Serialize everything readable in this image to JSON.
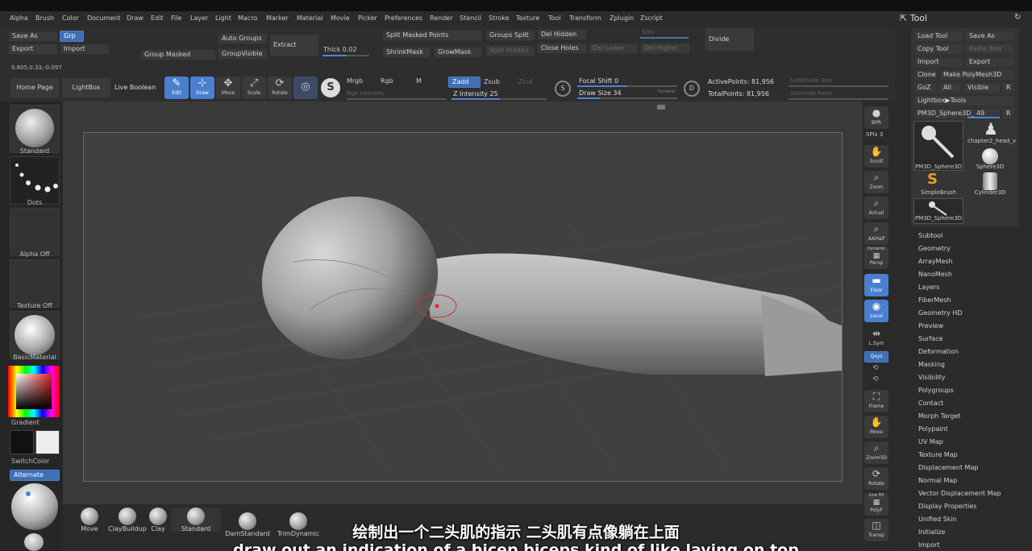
{
  "menus": [
    "Alpha",
    "Brush",
    "Color",
    "Document",
    "Draw",
    "Edit",
    "File",
    "Layer",
    "Light",
    "Macro",
    "Marker",
    "Material",
    "Movie",
    "Picker",
    "Preferences",
    "Render",
    "Stencil",
    "Stroke",
    "Texture",
    "Tool",
    "Transform",
    "Zplugin",
    "Zscript"
  ],
  "toolbar": {
    "save_as": "Save As",
    "grp": "Grp",
    "export": "Export",
    "import": "Import",
    "coords": "0.805,0.33,-0.097",
    "group_masked": "Group Masked",
    "auto_groups": "Auto Groups",
    "group_visible": "GroupVisible",
    "extract": "Extract",
    "thick_label": "Thick",
    "thick_value": "0.02",
    "split_masked": "Split Masked Points",
    "shrink_mask": "ShrinkMask",
    "grow_mask": "GrowMask",
    "groups_split": "Groups Split",
    "split_hidden": "Split Hidden",
    "del_hidden": "Del Hidden",
    "close_holes": "Close Holes",
    "del_lower": "Del Lower",
    "del_higher": "Del Higher",
    "sdiv": "SDiv",
    "divide": "Divide"
  },
  "toolbar2": {
    "home_page": "Home Page",
    "lightbox": "LightBox",
    "live_boolean": "Live Boolean",
    "edit": "Edit",
    "draw": "Draw",
    "move": "Move",
    "scale": "Scale",
    "rotate": "Rotate",
    "mrgb": "Mrgb",
    "rgb": "Rgb",
    "m": "M",
    "zadd": "Zadd",
    "zsub": "Zsub",
    "zcut": "Zcut",
    "rgb_intensity": "Rgb Intensity",
    "z_intensity_label": "Z Intensity",
    "z_intensity": "25",
    "focal_shift_label": "Focal Shift",
    "focal_shift": "0",
    "draw_size_label": "Draw Size",
    "draw_size": "34",
    "dynamic": "Dynamic",
    "active_points": "ActivePoints: 81,956",
    "total_points": "TotalPoints: 81,956",
    "subdivide_size": "SubDivide Size",
    "undivide_ratio": "UnDivide Ratio"
  },
  "left": {
    "standard": "Standard",
    "dots": "Dots",
    "alpha_off": "Alpha Off",
    "texture_off": "Texture Off",
    "material": "BasicMaterial",
    "gradient": "Gradient",
    "switch_color": "SwitchColor",
    "alternate": "Alternate"
  },
  "right_shelf": {
    "bpr": "BPR",
    "spix_label": "SPix",
    "spix": "3",
    "scroll": "Scroll",
    "zoom": "Zoom",
    "actual": "Actual",
    "aahalf": "AAHalf",
    "dynamic": "Dynamic",
    "persp": "Persp",
    "floor": "Floor",
    "local": "Local",
    "lsym": "L.Sym",
    "xyz": "Qxyz",
    "frame": "Frame",
    "move": "Move",
    "zoom3d": "Zoom3D",
    "rotate": "Rotate",
    "line_fill": "Line Fill",
    "polyf": "PolyF",
    "transp": "Transp"
  },
  "tool_panel": {
    "title": "Tool",
    "load_tool": "Load Tool",
    "save_as": "Save As",
    "copy_tool": "Copy Tool",
    "paste_tool": "Paste Tool",
    "import": "Import",
    "export": "Export",
    "clone": "Clone",
    "make_polymesh": "Make PolyMesh3D",
    "goz": "GoZ",
    "all": "All",
    "visible": "Visible",
    "r": "R",
    "lightbox_tools": "Lightbox▶Tools",
    "current_tool": "PM3D_Sphere3D_ 49",
    "thumbs": [
      "PM3D_Sphere3D",
      "chapter2_head_v",
      "Sphere3D",
      "SimpleBrush",
      "Cylinder3D",
      "PM3D_Sphere3D"
    ],
    "items": [
      "Subtool",
      "Geometry",
      "ArrayMesh",
      "NanoMesh",
      "Layers",
      "FiberMesh",
      "Geometry HD",
      "Preview",
      "Surface",
      "Deformation",
      "Masking",
      "Visibility",
      "Polygroups",
      "Contact",
      "Morph Target",
      "Polypaint",
      "UV Map",
      "Texture Map",
      "Displacement Map",
      "Normal Map",
      "Vector Displacement Map",
      "Display Properties",
      "Unified Skin",
      "Initialize",
      "Import"
    ]
  },
  "bottom_brushes": [
    "Move",
    "ClayBuildup",
    "Clay",
    "Standard",
    "DamStandard",
    "TrimDynamic"
  ],
  "subtitles": {
    "cn": "绘制出一个二头肌的指示 二头肌有点像躺在上面",
    "en": "draw out an indication of a bicep biceps kind of like laying on top"
  },
  "colors": {
    "accent": "#4a7fd0",
    "panel": "#2b2b2b",
    "canvas": "#3a3a3a"
  }
}
